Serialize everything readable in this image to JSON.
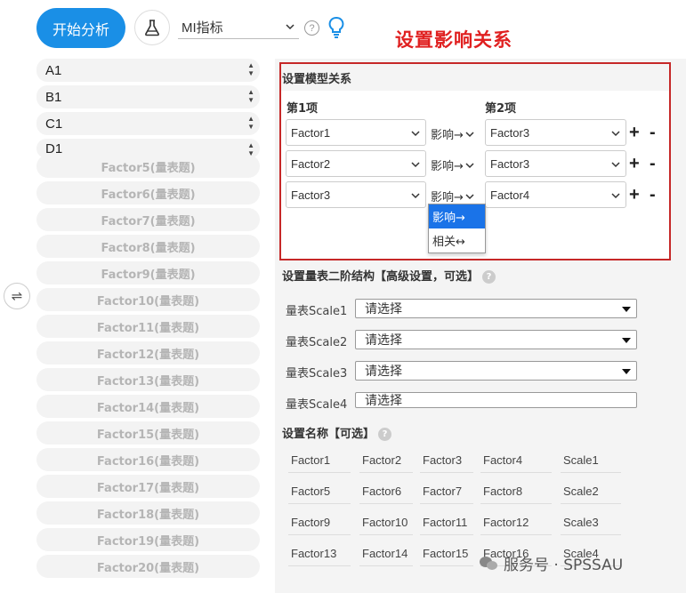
{
  "toolbar": {
    "start_label": "开始分析",
    "mi_select_value": "MI指标",
    "help_glyph": "?",
    "headline": "设置影响关系"
  },
  "variables": [
    "A1",
    "B1",
    "C1",
    "D1"
  ],
  "factors": [
    "Factor5(量表题)",
    "Factor6(量表题)",
    "Factor7(量表题)",
    "Factor8(量表题)",
    "Factor9(量表题)",
    "Factor10(量表题)",
    "Factor11(量表题)",
    "Factor12(量表题)",
    "Factor13(量表题)",
    "Factor14(量表题)",
    "Factor15(量表题)",
    "Factor16(量表题)",
    "Factor17(量表题)",
    "Factor18(量表题)",
    "Factor19(量表题)",
    "Factor20(量表题)"
  ],
  "swap_glyph": "⇌",
  "model": {
    "title": "设置模型关系",
    "col1": "第1项",
    "col2": "第2项",
    "rows": [
      {
        "item1": "Factor1",
        "relation": "影响→",
        "item2": "Factor3"
      },
      {
        "item1": "Factor2",
        "relation": "影响→",
        "item2": "Factor3"
      },
      {
        "item1": "Factor3",
        "relation": "影响→",
        "item2": "Factor4"
      }
    ],
    "add": "+",
    "remove": "-",
    "dropdown_options": [
      "影响→",
      "相关↔"
    ]
  },
  "scales": {
    "title": "设置量表二阶结构【高级设置，可选】",
    "help": "?",
    "rows": [
      {
        "label": "量表Scale1",
        "value": "请选择"
      },
      {
        "label": "量表Scale2",
        "value": "请选择"
      },
      {
        "label": "量表Scale3",
        "value": "请选择"
      },
      {
        "label": "量表Scale4",
        "value": "请选择"
      }
    ]
  },
  "names": {
    "title": "设置名称【可选】",
    "help": "?",
    "grid": [
      [
        "Factor1",
        "Factor2",
        "Factor3",
        "Factor4",
        "Scale1"
      ],
      [
        "Factor5",
        "Factor6",
        "Factor7",
        "Factor8",
        "Scale2"
      ],
      [
        "Factor9",
        "Factor10",
        "Factor11",
        "Factor12",
        "Scale3"
      ],
      [
        "Factor13",
        "Factor14",
        "Factor15",
        "Factor16",
        "Scale4"
      ]
    ]
  },
  "watermark": "服务号 · SPSSAU",
  "colors": {
    "primary": "#1a8fe6",
    "highlight_red": "#e02020",
    "box_border": "#c62828",
    "selected_option": "#1a73e8"
  }
}
